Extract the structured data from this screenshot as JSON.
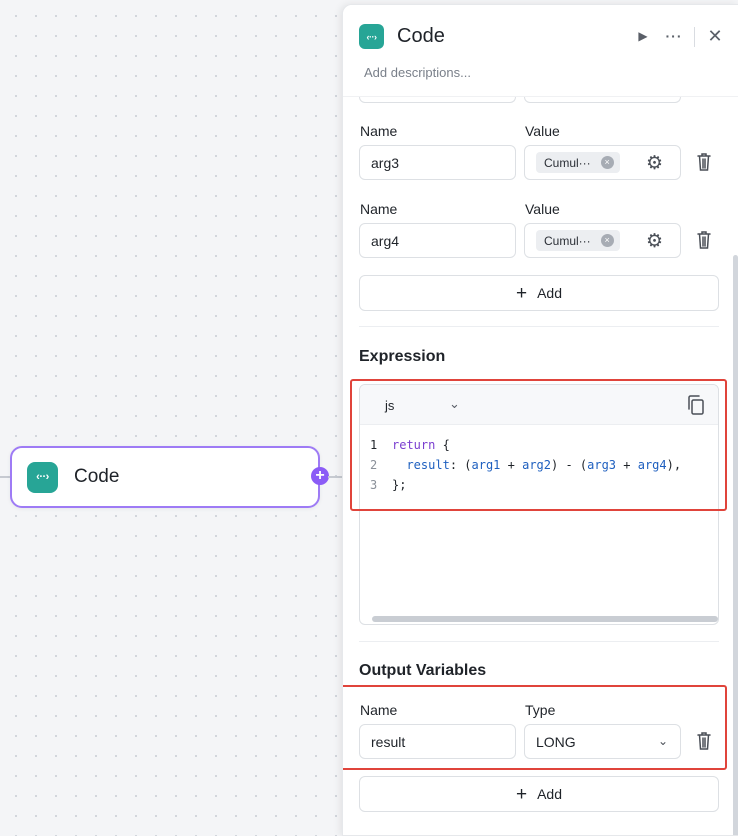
{
  "canvas": {
    "node": {
      "title": "Code",
      "icon": "code-brackets-icon",
      "icon_glyph": "‹··›",
      "port_glyph": "+"
    }
  },
  "panel": {
    "title": "Code",
    "icon_glyph": "‹··›",
    "description_placeholder": "Add descriptions...",
    "header_buttons": {
      "run_glyph": "▶",
      "more_glyph": "···",
      "close_glyph": "✕"
    }
  },
  "inputs": {
    "name_label": "Name",
    "value_label": "Value",
    "rows": [
      {
        "name": "arg3",
        "value_chip": "Cumul···",
        "chip_clear": "×",
        "gear_glyph": "⚙"
      },
      {
        "name": "arg4",
        "value_chip": "Cumul···",
        "chip_clear": "×",
        "gear_glyph": "⚙"
      }
    ],
    "add_label": "Add",
    "add_glyph": "+"
  },
  "expression": {
    "title": "Expression",
    "language": "js",
    "chevron_glyph": "⌄",
    "lines": [
      {
        "num": "1",
        "text": "return {"
      },
      {
        "num": "2",
        "text": "  result: (arg1 + arg2) - (arg3 + arg4),"
      },
      {
        "num": "3",
        "text": "};"
      }
    ]
  },
  "outputs": {
    "title": "Output Variables",
    "name_label": "Name",
    "type_label": "Type",
    "rows": [
      {
        "name": "result",
        "type": "LONG",
        "chevron_glyph": "⌄"
      }
    ],
    "add_label": "Add",
    "add_glyph": "+"
  },
  "colors": {
    "accent": "#8b5cf6",
    "node_border": "#9e7bf5",
    "icon_bg": "#27a596",
    "highlight": "#e0443b"
  }
}
